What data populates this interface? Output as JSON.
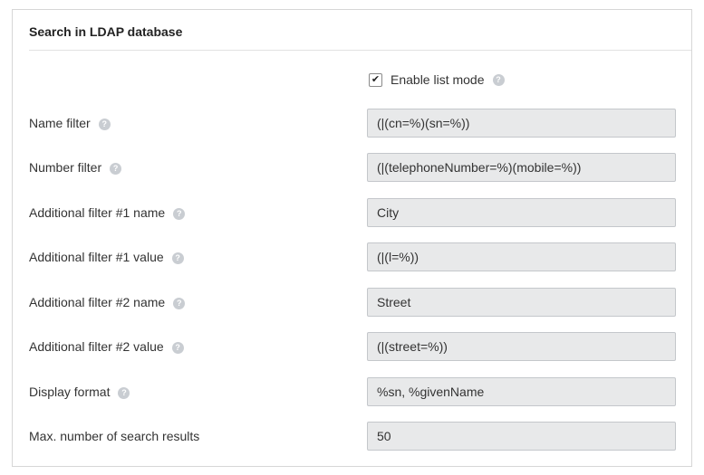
{
  "panel": {
    "title": "Search in LDAP database"
  },
  "list_mode": {
    "label": "Enable list mode",
    "checked": true
  },
  "fields": [
    {
      "label": "Name filter",
      "value": "(|(cn=%)(sn=%))",
      "help": true
    },
    {
      "label": "Number filter",
      "value": "(|(telephoneNumber=%)(mobile=%))",
      "help": true
    },
    {
      "label": "Additional filter #1 name",
      "value": "City",
      "help": true
    },
    {
      "label": "Additional filter #1 value",
      "value": "(|(l=%))",
      "help": true
    },
    {
      "label": "Additional filter #2 name",
      "value": "Street",
      "help": true
    },
    {
      "label": "Additional filter #2 value",
      "value": "(|(street=%))",
      "help": true
    },
    {
      "label": "Display format",
      "value": "%sn, %givenName",
      "help": true
    },
    {
      "label": "Max. number of search results",
      "value": "50",
      "help": false
    }
  ],
  "icons": {
    "help": "question-mark-circle-icon",
    "check": "checkmark-icon"
  }
}
